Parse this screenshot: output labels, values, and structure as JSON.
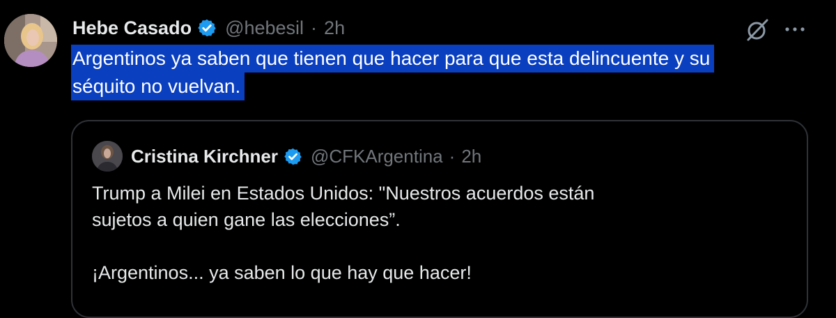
{
  "tweet": {
    "display_name": "Hebe Casado",
    "handle": "@hebesil",
    "separator": "·",
    "time": "2h",
    "text_lines": [
      "Argentinos ya saben que tienen que hacer para que esta delincuente y su",
      "séquito no vuelvan."
    ],
    "verified_icon": "verified-badge-icon",
    "grok_icon": "grok-icon",
    "more_icon": "more-options-icon",
    "selection_color": "#0a3fbf",
    "verified_color": "#1d9bf0"
  },
  "quoted_tweet": {
    "display_name": "Cristina Kirchner",
    "handle": "@CFKArgentina",
    "separator": "·",
    "time": "2h",
    "paragraph_1_line_1": "Trump a Milei en Estados Unidos: \"Nuestros acuerdos están",
    "paragraph_1_line_2": "sujetos a quien gane las elecciones”.",
    "paragraph_2": "¡Argentinos... ya saben lo que hay que hacer!"
  }
}
